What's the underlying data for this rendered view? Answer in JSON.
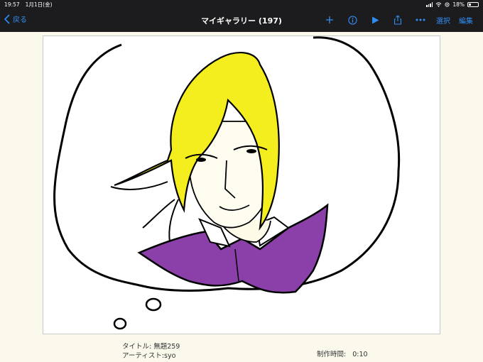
{
  "status_bar": {
    "time": "19:57",
    "date": "1月1日(金)",
    "battery": "18%"
  },
  "nav": {
    "back_label": "戻る",
    "title": "マイギャラリー (197)",
    "select_label": "選択",
    "edit_label": "編集",
    "accent_color": "#2f8ef6"
  },
  "artwork": {
    "title_label": "タイトル: 無題259",
    "artist_label": "アーティスト:syo",
    "time_label": "制作時間:",
    "time_value": "0:10"
  },
  "icons": [
    "chevron-left-icon",
    "plus-icon",
    "info-icon",
    "play-icon",
    "share-icon",
    "more-icon",
    "wifi-icon",
    "battery-icon"
  ]
}
